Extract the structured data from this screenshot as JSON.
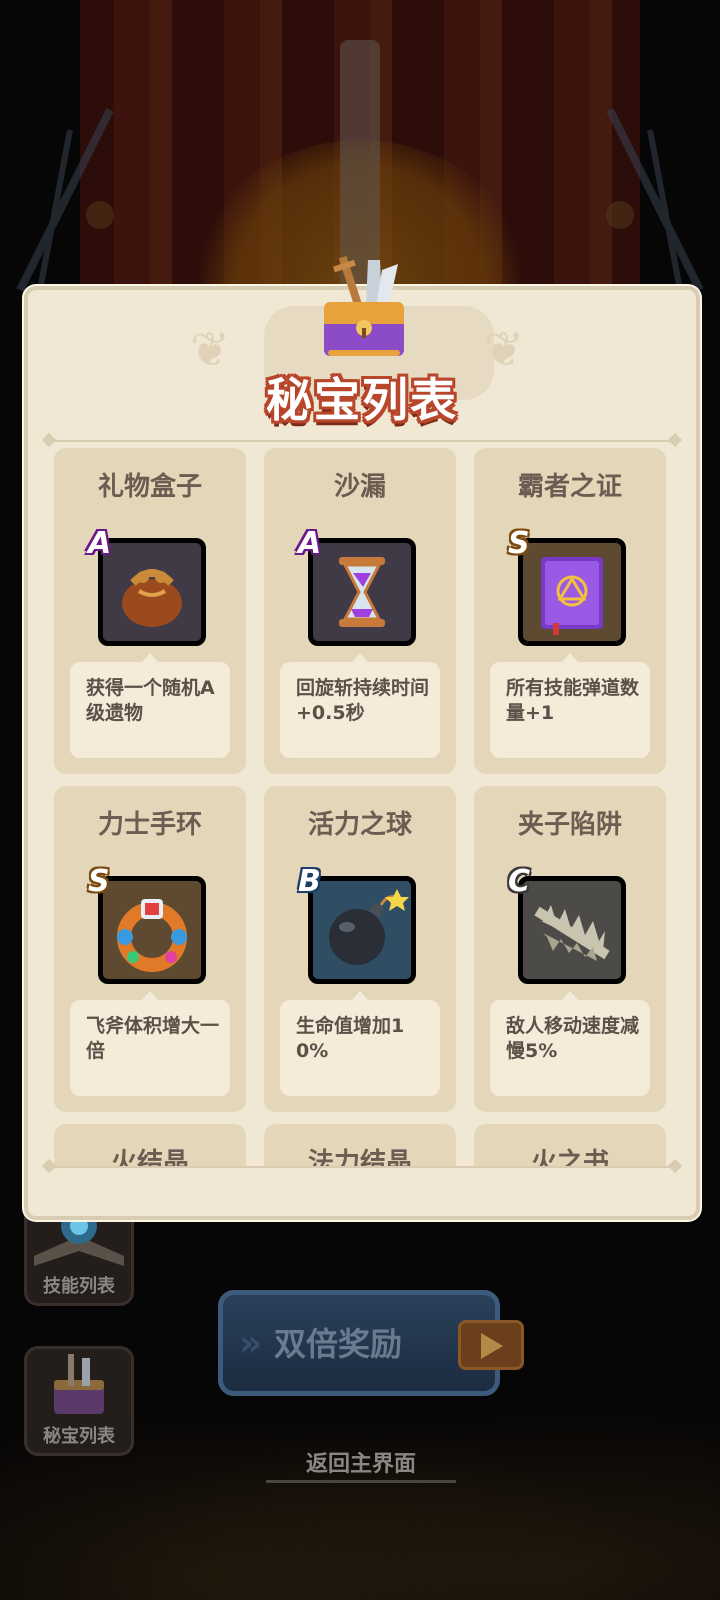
{
  "panel": {
    "title": "秘宝列表"
  },
  "items": [
    {
      "name": "礼物盒子",
      "rank": "A",
      "desc": "获得一个随机A级遗物",
      "icon": "loot-bag-icon"
    },
    {
      "name": "沙漏",
      "rank": "A",
      "desc": "回旋斩持续时间+0.5秒",
      "icon": "hourglass-icon"
    },
    {
      "name": "霸者之证",
      "rank": "S",
      "desc": "所有技能弹道数量+1",
      "icon": "spellbook-icon"
    },
    {
      "name": "力士手环",
      "rank": "S",
      "desc": "飞斧体积增大一倍",
      "icon": "gem-bracelet-icon"
    },
    {
      "name": "活力之球",
      "rank": "B",
      "desc": "生命值增加10%",
      "icon": "bomb-icon"
    },
    {
      "name": "夹子陷阱",
      "rank": "C",
      "desc": "敌人移动速度减慢5%",
      "icon": "bear-trap-icon"
    },
    {
      "name": "火结晶",
      "rank": "",
      "desc": "",
      "icon": ""
    },
    {
      "name": "法力结晶",
      "rank": "",
      "desc": "",
      "icon": ""
    },
    {
      "name": "火之书",
      "rank": "",
      "desc": "",
      "icon": ""
    }
  ],
  "side_buttons": {
    "skills_label": "技能列表",
    "treasures_label": "秘宝列表"
  },
  "bottom": {
    "double_reward_label": "双倍奖励",
    "home_label": "返回主界面"
  },
  "colors": {
    "rank_A": "#c33be0",
    "rank_S": "#d49028",
    "rank_B": "#3a8ec8",
    "rank_C": "#9b978f",
    "title_outline": "#b8462a"
  }
}
